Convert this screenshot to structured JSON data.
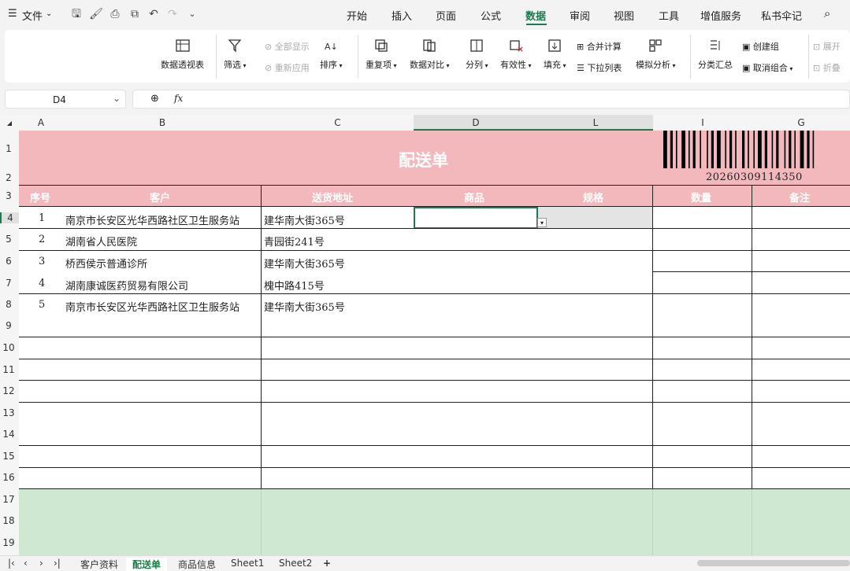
{
  "menu": {
    "file_label": "文件",
    "tabs": [
      "开始",
      "插入",
      "页面",
      "公式",
      "数据",
      "审阅",
      "视图",
      "工具",
      "增值服务",
      "私书伞记"
    ],
    "active_tab": "数据"
  },
  "ribbon": {
    "pivot": "数据透视表",
    "filter": "筛选",
    "show_all": "全部显示",
    "reapply": "重新应用",
    "sort": "排序",
    "duplicates": "重复项",
    "compare": "数据对比",
    "split": "分列",
    "validity": "有效性",
    "fill": "填充",
    "merge_calc": "合并计算",
    "dropdown_list": "下拉列表",
    "simulate": "模拟分析",
    "subtotal": "分类汇总",
    "create_group": "创建组",
    "ungroup": "取消组合",
    "expand": "展开",
    "collapse": "折叠"
  },
  "formula_bar": {
    "cell_ref": "D4",
    "fx": "fx",
    "value": ""
  },
  "columns": [
    "A",
    "B",
    "C",
    "D",
    "L",
    "I",
    "G"
  ],
  "rows": [
    "1",
    "2",
    "3",
    "4",
    "5",
    "6",
    "7",
    "8",
    "9",
    "10",
    "11",
    "12",
    "13",
    "14",
    "15",
    "16",
    "17",
    "18",
    "19"
  ],
  "sheet": {
    "title": "配送单",
    "barcode_number": "20260309114350",
    "headers": [
      "序号",
      "客户",
      "送货地址",
      "商品",
      "规格",
      "数量",
      "备注"
    ],
    "records": [
      {
        "no": "1",
        "customer": "南京市长安区光华西路社区卫生服务站",
        "address": "建华南大街365号"
      },
      {
        "no": "2",
        "customer": "湖南省人民医院",
        "address": "青园街241号"
      },
      {
        "no": "3",
        "customer": "桥西侯示普通诊所",
        "address": "建华南大街365号"
      },
      {
        "no": "4",
        "customer": "湖南康诚医药贸易有限公司",
        "address": "槐中路415号"
      },
      {
        "no": "5",
        "customer": "南京市长安区光华西路社区卫生服务站",
        "address": "建华南大街365号"
      }
    ],
    "colors": {
      "header_pink": "#f2b8bc",
      "footer_green": "#cfe8d1",
      "accent": "#1e7a4a"
    }
  },
  "sheet_tabs": [
    "客户资料",
    "配送单",
    "商品信息",
    "Sheet1",
    "Sheet2"
  ],
  "active_sheet": "配送单",
  "add_sheet": "+"
}
